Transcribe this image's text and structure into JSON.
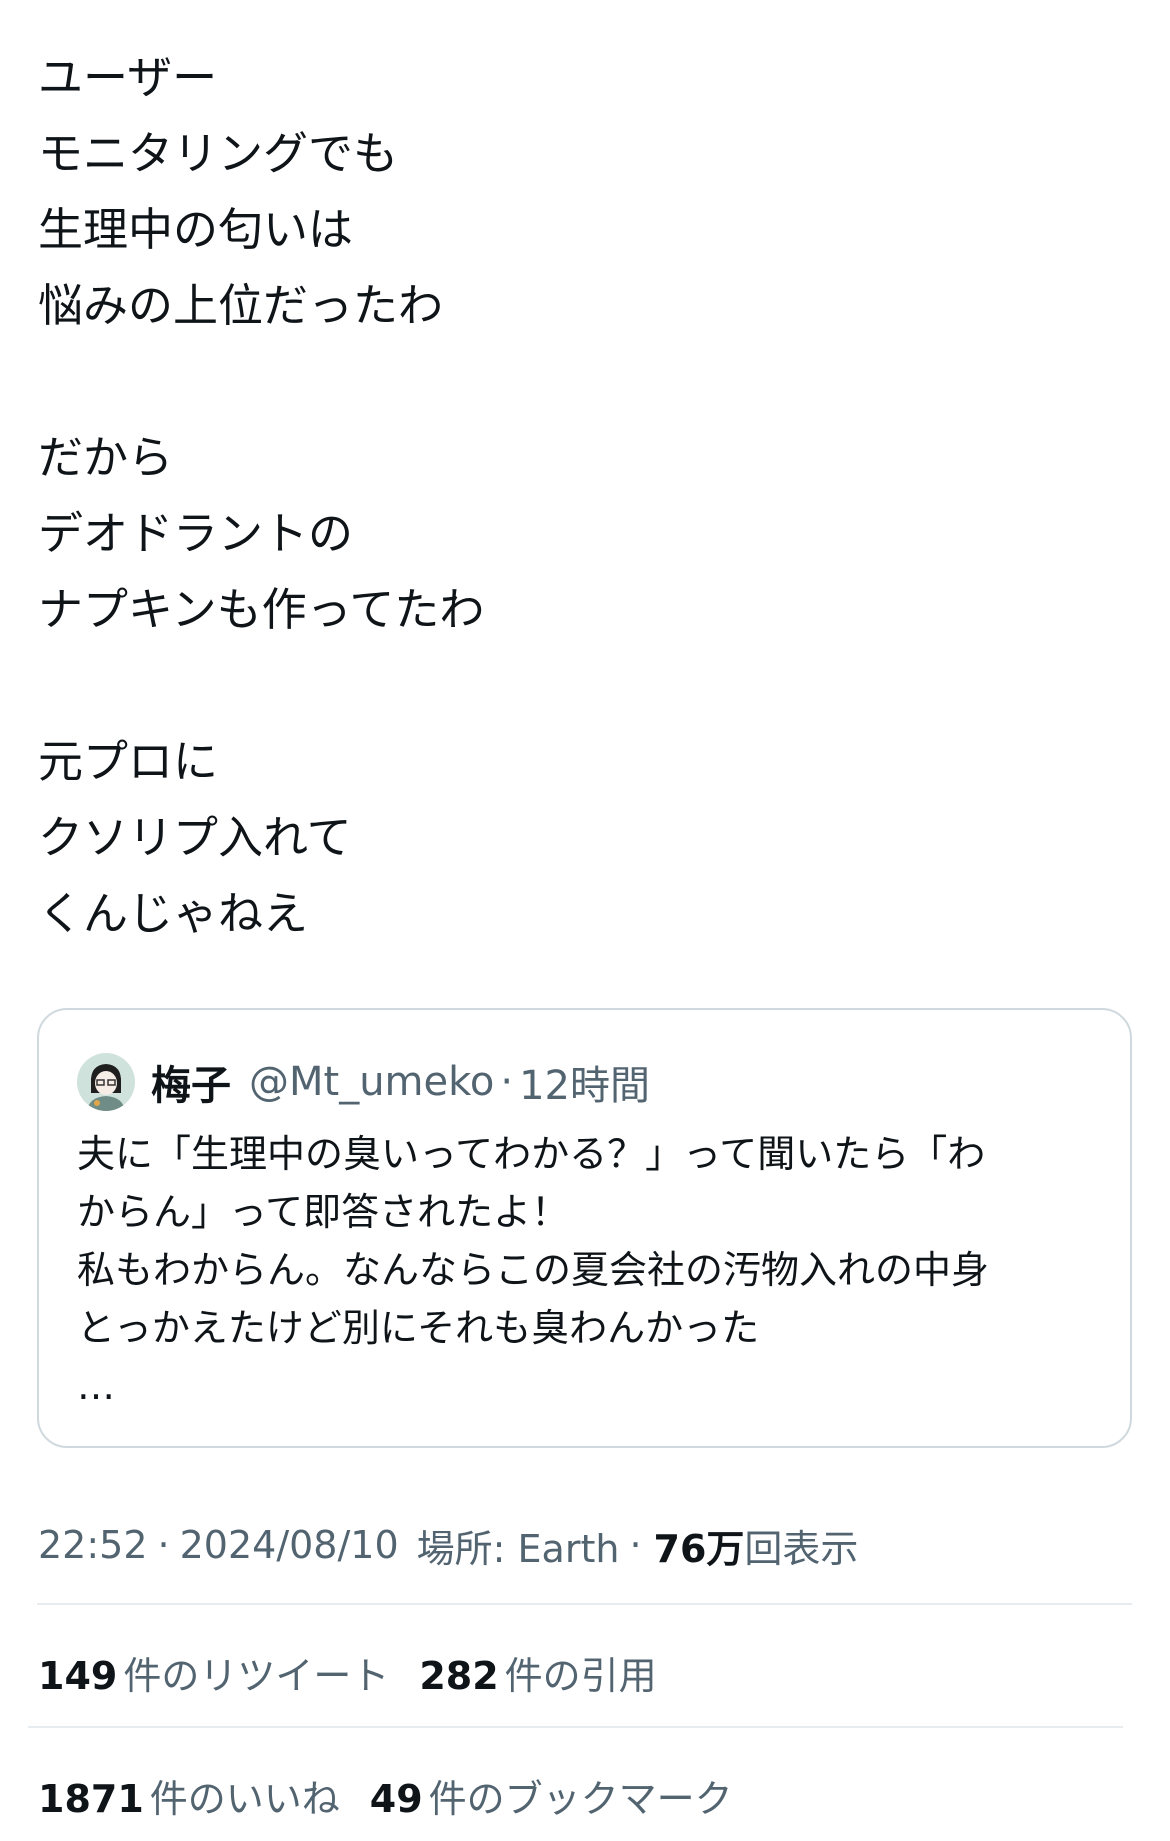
{
  "tweet": {
    "lines": [
      "ユーザー",
      "モニタリングでも",
      "生理中の匂いは",
      "悩みの上位だったわ",
      "",
      "だから",
      "デオドラントの",
      "ナプキンも作ってたわ",
      "",
      "元プロに",
      "クソリプ入れて",
      "くんじゃねえ"
    ]
  },
  "quote": {
    "name": "梅子",
    "handle": "@Mt_umeko",
    "separator": "·",
    "time": "12時間",
    "lines": [
      "夫に「生理中の臭いってわかる？」って聞いたら「わ",
      "からん」って即答されたよ！",
      "私もわからん。なんならこの夏会社の汚物入れの中身",
      "とっかえたけど別にそれも臭わんかった",
      "…"
    ]
  },
  "meta": {
    "time": "22:52",
    "separator": "·",
    "date": "2024/08/10",
    "location": "場所: Earth",
    "views_count": "76万",
    "views_label": "回表示"
  },
  "stats": {
    "retweets": {
      "count": "149",
      "label": "件のリツイート"
    },
    "quotes": {
      "count": "282",
      "label": "件の引用"
    },
    "likes": {
      "count": "1871",
      "label": "件のいいね"
    },
    "bookmarks": {
      "count": "49",
      "label": "件のブックマーク"
    }
  }
}
